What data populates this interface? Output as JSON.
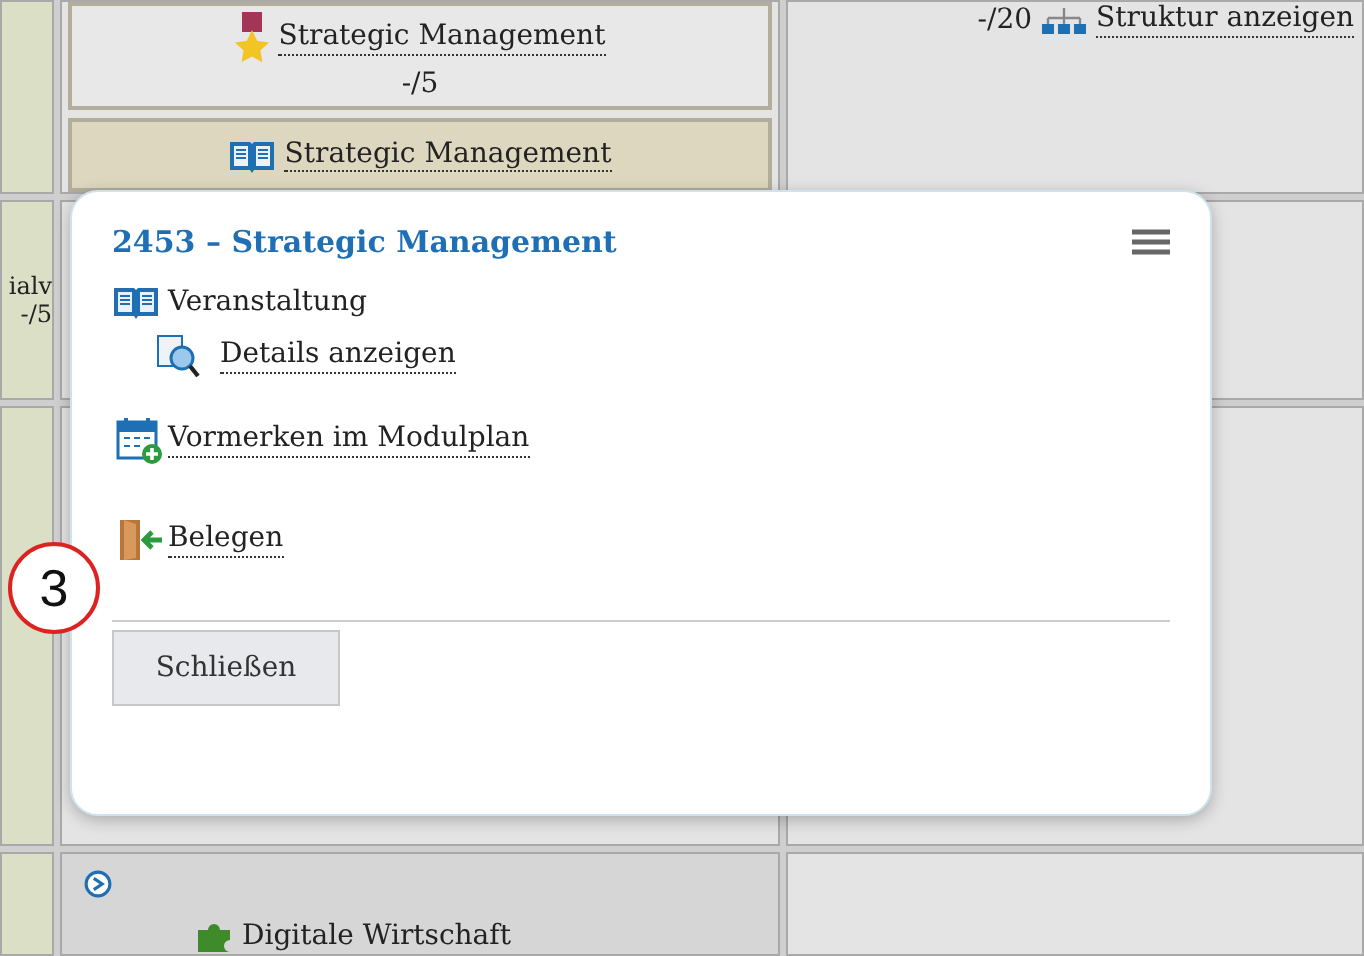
{
  "grid": {
    "left_texts": [
      "ialv",
      "-/5"
    ],
    "modules": [
      {
        "kind": "achievement",
        "title": "Strategic Management",
        "score": "-/5"
      },
      {
        "kind": "course",
        "title": "Strategic Management"
      }
    ],
    "structure": {
      "score": "-/20",
      "link": "Struktur anzeigen"
    },
    "lower_module": {
      "title": "Digitale Wirtschaft"
    }
  },
  "popup": {
    "title": "2453 – Strategic Management",
    "section": "Veranstaltung",
    "actions": [
      {
        "kind": "details",
        "label": "Details anzeigen"
      },
      {
        "kind": "bookmark",
        "label": "Vormerken im Modulplan"
      },
      {
        "kind": "enroll",
        "label": "Belegen"
      }
    ],
    "close_button": "Schließen"
  },
  "annotation": "3"
}
